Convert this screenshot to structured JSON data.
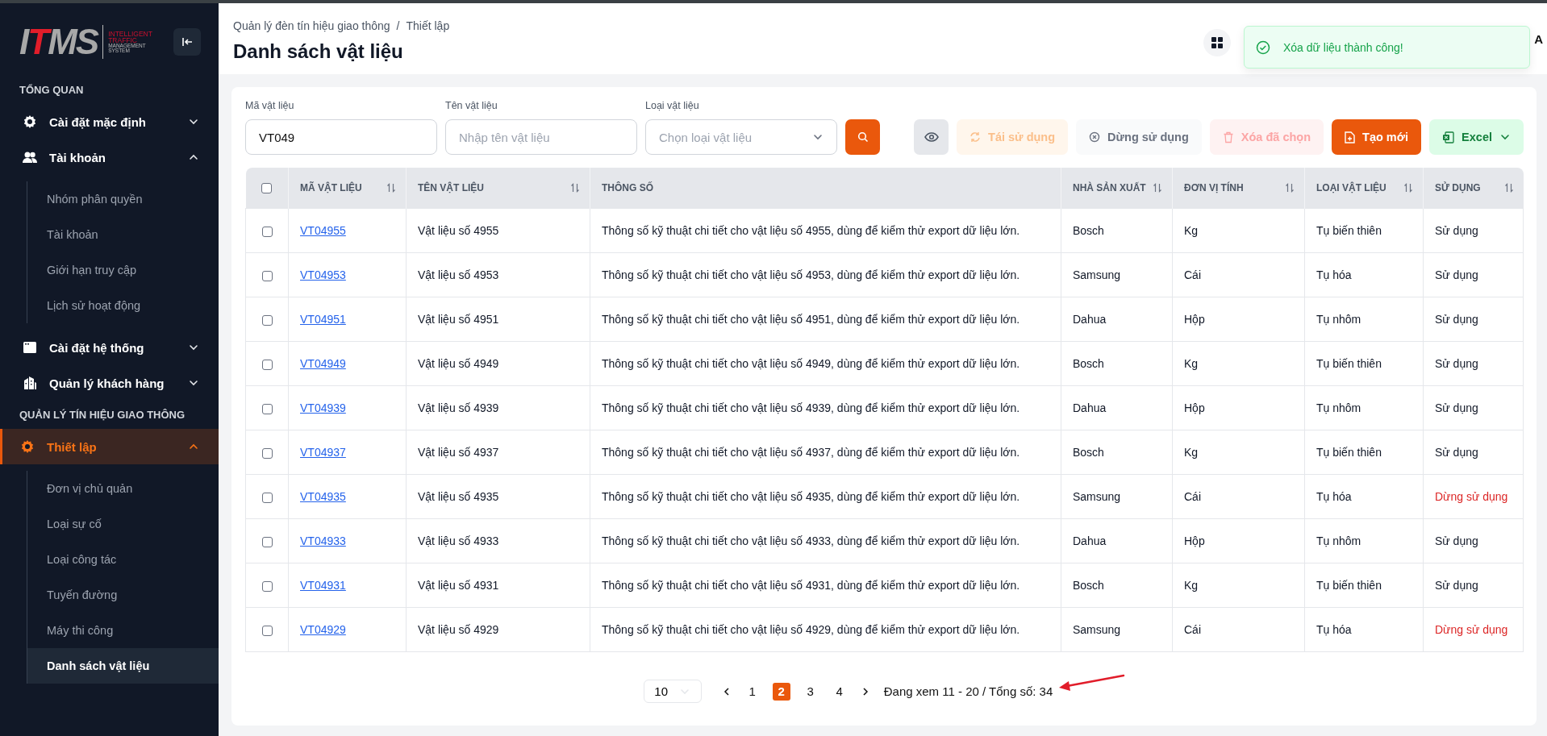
{
  "logo": {
    "wordmark_start": "I",
    "wordmark_accent": "T",
    "wordmark_end": "MS",
    "tagline_top": [
      "INTELLIGENT",
      "TRAFFIC"
    ],
    "tagline_bottom": [
      "MANAGEMENT",
      "SYSTEM"
    ]
  },
  "sidebar": {
    "sections": [
      {
        "title": "TỔNG QUAN",
        "items": [
          {
            "label": "Cài đặt mặc định",
            "expanded": false,
            "selected": false
          },
          {
            "label": "Tài khoản",
            "expanded": true,
            "selected": false,
            "children": [
              {
                "label": "Nhóm phân quyền",
                "selected": false
              },
              {
                "label": "Tài khoản",
                "selected": false
              },
              {
                "label": "Giới hạn truy cập",
                "selected": false
              },
              {
                "label": "Lịch sử hoạt động",
                "selected": false
              }
            ]
          },
          {
            "label": "Cài đặt hệ thống",
            "expanded": false,
            "selected": false
          },
          {
            "label": "Quản lý khách hàng",
            "expanded": false,
            "selected": false
          }
        ]
      },
      {
        "title": "QUẢN LÝ TÍN HIỆU GIAO THÔNG",
        "items": [
          {
            "label": "Thiết lập",
            "expanded": true,
            "selected": true,
            "children": [
              {
                "label": "Đơn vị chủ quản",
                "selected": false
              },
              {
                "label": "Loại sự cố",
                "selected": false
              },
              {
                "label": "Loại công tác",
                "selected": false
              },
              {
                "label": "Tuyến đường",
                "selected": false
              },
              {
                "label": "Máy thi công",
                "selected": false
              },
              {
                "label": "Danh sách vật liệu",
                "selected": true
              }
            ]
          }
        ]
      }
    ]
  },
  "header": {
    "breadcrumb": [
      "Quản lý đèn tín hiệu giao thông",
      "Thiết lập"
    ],
    "breadcrumb_separator": "/",
    "title": "Danh sách vật liệu",
    "user_initial": "A"
  },
  "toast": {
    "message": "Xóa dữ liệu thành công!"
  },
  "filters": [
    {
      "label": "Mã vật liệu",
      "kind": "text",
      "value": "VT049"
    },
    {
      "label": "Tên vật liệu",
      "kind": "text",
      "placeholder": "Nhập tên vật liệu"
    },
    {
      "label": "Loại vật liệu",
      "kind": "select",
      "placeholder": "Chọn loại vật liệu"
    }
  ],
  "actions": [
    {
      "kind": "view",
      "disabled": false
    },
    {
      "kind": "reuse",
      "label": "Tái sử dụng",
      "disabled": true
    },
    {
      "kind": "stop",
      "label": "Dừng sử dụng",
      "disabled": true
    },
    {
      "kind": "delete",
      "label": "Xóa đã chọn",
      "disabled": true
    },
    {
      "kind": "create",
      "label": "Tạo mới",
      "disabled": false
    },
    {
      "kind": "excel",
      "label": "Excel",
      "disabled": false
    }
  ],
  "table": {
    "select_all_checked": false,
    "columns": [
      {
        "label": "MÃ VẬT LIỆU",
        "sortable": true
      },
      {
        "label": "TÊN VẬT LIỆU",
        "sortable": true
      },
      {
        "label": "THÔNG SỐ",
        "sortable": false
      },
      {
        "label": "NHÀ SẢN XUẤT",
        "sortable": true
      },
      {
        "label": "ĐƠN VỊ TÍNH",
        "sortable": true
      },
      {
        "label": "LOẠI VẬT LIỆU",
        "sortable": true
      },
      {
        "label": "SỬ DỤNG",
        "sortable": true
      }
    ],
    "rows": [
      {
        "checked": false,
        "code": "VT04955",
        "name": "Vật liệu số 4955",
        "spec": "Thông số kỹ thuật chi tiết cho vật liệu số 4955, dùng để kiểm thử export dữ liệu lớn.",
        "maker": "Bosch",
        "unit": "Kg",
        "type": "Tụ biến thiên",
        "status": "Sử dụng",
        "stopped": false
      },
      {
        "checked": false,
        "code": "VT04953",
        "name": "Vật liệu số 4953",
        "spec": "Thông số kỹ thuật chi tiết cho vật liệu số 4953, dùng để kiểm thử export dữ liệu lớn.",
        "maker": "Samsung",
        "unit": "Cái",
        "type": "Tụ hóa",
        "status": "Sử dụng",
        "stopped": false
      },
      {
        "checked": false,
        "code": "VT04951",
        "name": "Vật liệu số 4951",
        "spec": "Thông số kỹ thuật chi tiết cho vật liệu số 4951, dùng để kiểm thử export dữ liệu lớn.",
        "maker": "Dahua",
        "unit": "Hộp",
        "type": "Tụ nhôm",
        "status": "Sử dụng",
        "stopped": false
      },
      {
        "checked": false,
        "code": "VT04949",
        "name": "Vật liệu số 4949",
        "spec": "Thông số kỹ thuật chi tiết cho vật liệu số 4949, dùng để kiểm thử export dữ liệu lớn.",
        "maker": "Bosch",
        "unit": "Kg",
        "type": "Tụ biến thiên",
        "status": "Sử dụng",
        "stopped": false
      },
      {
        "checked": false,
        "code": "VT04939",
        "name": "Vật liệu số 4939",
        "spec": "Thông số kỹ thuật chi tiết cho vật liệu số 4939, dùng để kiểm thử export dữ liệu lớn.",
        "maker": "Dahua",
        "unit": "Hộp",
        "type": "Tụ nhôm",
        "status": "Sử dụng",
        "stopped": false
      },
      {
        "checked": false,
        "code": "VT04937",
        "name": "Vật liệu số 4937",
        "spec": "Thông số kỹ thuật chi tiết cho vật liệu số 4937, dùng để kiểm thử export dữ liệu lớn.",
        "maker": "Bosch",
        "unit": "Kg",
        "type": "Tụ biến thiên",
        "status": "Sử dụng",
        "stopped": false
      },
      {
        "checked": false,
        "code": "VT04935",
        "name": "Vật liệu số 4935",
        "spec": "Thông số kỹ thuật chi tiết cho vật liệu số 4935, dùng để kiểm thử export dữ liệu lớn.",
        "maker": "Samsung",
        "unit": "Cái",
        "type": "Tụ hóa",
        "status": "Dừng sử dụng",
        "stopped": true
      },
      {
        "checked": false,
        "code": "VT04933",
        "name": "Vật liệu số 4933",
        "spec": "Thông số kỹ thuật chi tiết cho vật liệu số 4933, dùng để kiểm thử export dữ liệu lớn.",
        "maker": "Dahua",
        "unit": "Hộp",
        "type": "Tụ nhôm",
        "status": "Sử dụng",
        "stopped": false
      },
      {
        "checked": false,
        "code": "VT04931",
        "name": "Vật liệu số 4931",
        "spec": "Thông số kỹ thuật chi tiết cho vật liệu số 4931, dùng để kiểm thử export dữ liệu lớn.",
        "maker": "Bosch",
        "unit": "Kg",
        "type": "Tụ biến thiên",
        "status": "Sử dụng",
        "stopped": false
      },
      {
        "checked": false,
        "code": "VT04929",
        "name": "Vật liệu số 4929",
        "spec": "Thông số kỹ thuật chi tiết cho vật liệu số 4929, dùng để kiểm thử export dữ liệu lớn.",
        "maker": "Samsung",
        "unit": "Cái",
        "type": "Tụ hóa",
        "status": "Dừng sử dụng",
        "stopped": true
      }
    ]
  },
  "pagination": {
    "page_size": "10",
    "pages": [
      {
        "label": "1",
        "selected": false
      },
      {
        "label": "2",
        "selected": true
      },
      {
        "label": "3",
        "selected": false
      },
      {
        "label": "4",
        "selected": false
      }
    ],
    "summary": "Đang xem 11 - 20 / Tổng số: 34"
  },
  "annotation": {
    "kind": "arrow"
  }
}
